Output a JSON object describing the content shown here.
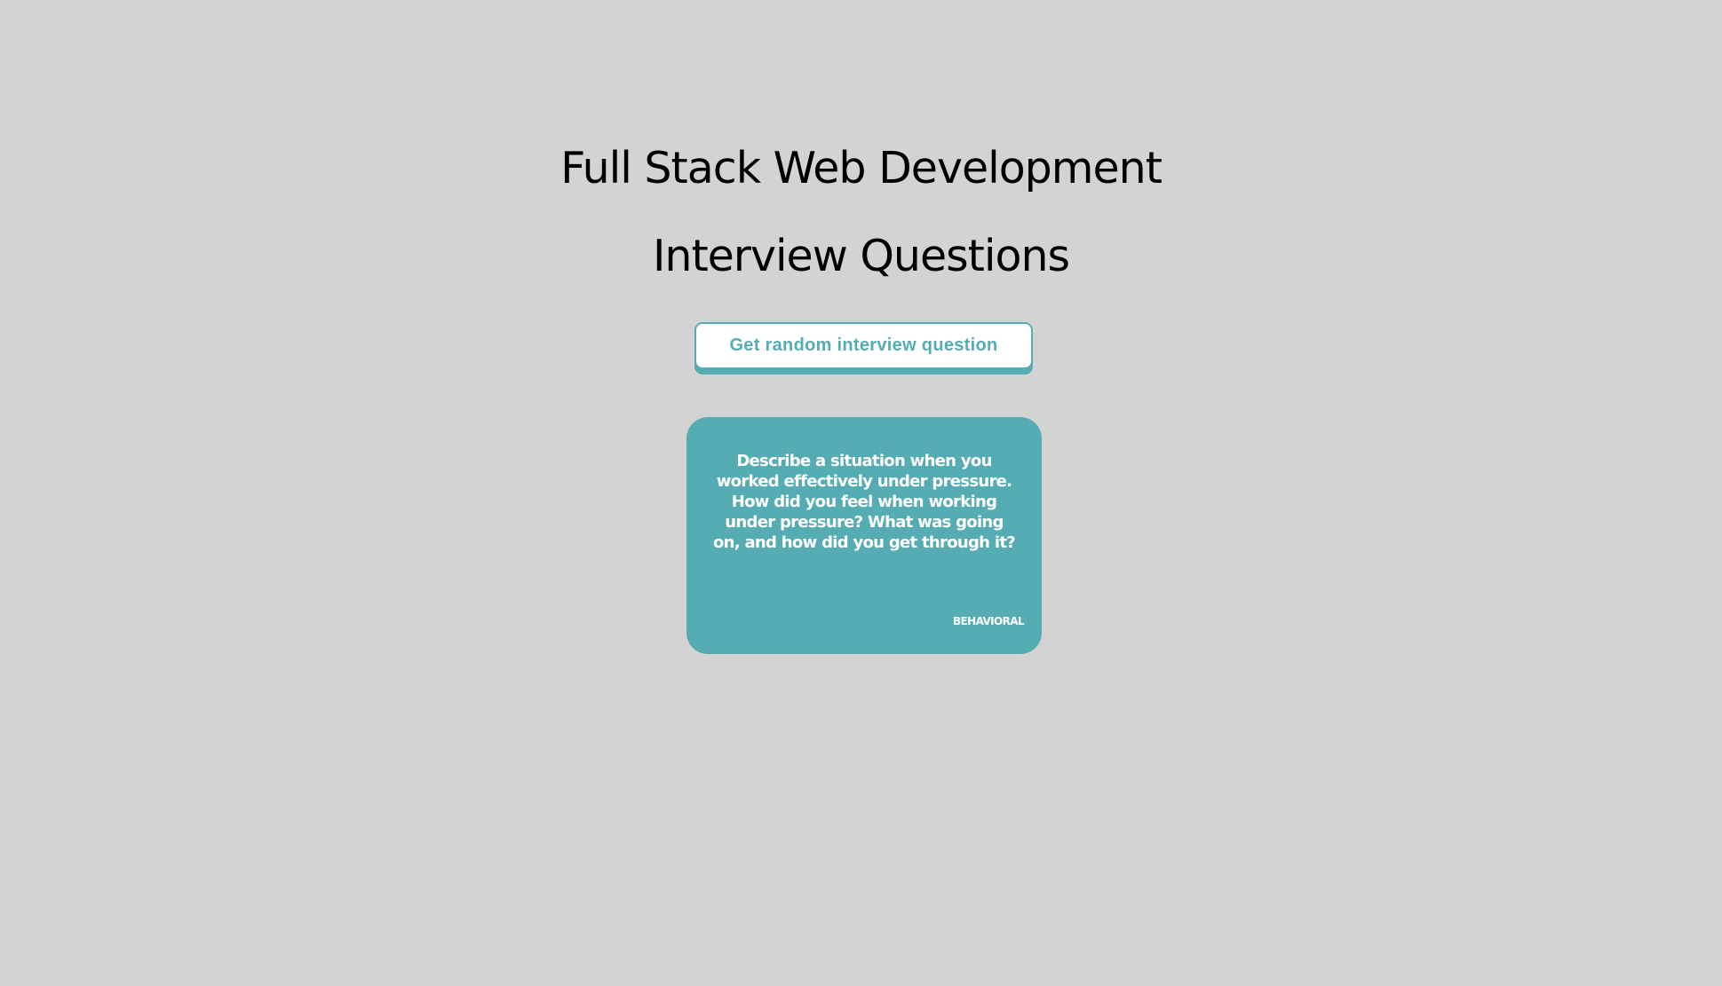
{
  "header": {
    "title_line1": "Full Stack Web Development",
    "title_line2": "Interview Questions"
  },
  "actions": {
    "random_question_label": "Get random interview question"
  },
  "question_card": {
    "text": "Describe a situation when you worked effectively under pressure. How did you feel when working under pressure? What was going on, and how did you get through it?",
    "category": "BEHAVIORAL"
  },
  "colors": {
    "background": "#d3d3d3",
    "accent": "#55adb3",
    "button_background": "#ffffff",
    "card_text": "#ffffff",
    "title_text": "#000000"
  }
}
